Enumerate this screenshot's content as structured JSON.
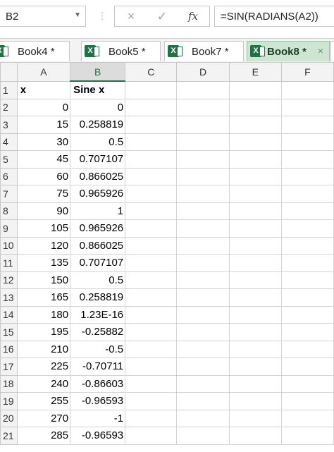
{
  "formula_bar": {
    "name_box": "B2",
    "formula": "=SIN(RADIANS(A2))",
    "cancel_icon": "×",
    "enter_icon": "✓",
    "fx_icon": "fx"
  },
  "tabs": [
    {
      "label": "Book4 *",
      "active": false
    },
    {
      "label": "Book5 *",
      "active": false
    },
    {
      "label": "Book7 *",
      "active": false
    },
    {
      "label": "Book8 *",
      "active": true,
      "close": "×"
    }
  ],
  "columns": [
    "A",
    "B",
    "C",
    "D",
    "E",
    "F"
  ],
  "selected_column": "B",
  "rows": [
    {
      "n": "1",
      "a": "x",
      "b": "Sine x"
    },
    {
      "n": "2",
      "a": "0",
      "b": "0"
    },
    {
      "n": "3",
      "a": "15",
      "b": "0.258819"
    },
    {
      "n": "4",
      "a": "30",
      "b": "0.5"
    },
    {
      "n": "5",
      "a": "45",
      "b": "0.707107"
    },
    {
      "n": "6",
      "a": "60",
      "b": "0.866025"
    },
    {
      "n": "7",
      "a": "75",
      "b": "0.965926"
    },
    {
      "n": "8",
      "a": "90",
      "b": "1"
    },
    {
      "n": "9",
      "a": "105",
      "b": "0.965926"
    },
    {
      "n": "10",
      "a": "120",
      "b": "0.866025"
    },
    {
      "n": "11",
      "a": "135",
      "b": "0.707107"
    },
    {
      "n": "12",
      "a": "150",
      "b": "0.5"
    },
    {
      "n": "13",
      "a": "165",
      "b": "0.258819"
    },
    {
      "n": "14",
      "a": "180",
      "b": "1.23E-16"
    },
    {
      "n": "15",
      "a": "195",
      "b": "-0.25882"
    },
    {
      "n": "16",
      "a": "210",
      "b": "-0.5"
    },
    {
      "n": "17",
      "a": "225",
      "b": "-0.70711"
    },
    {
      "n": "18",
      "a": "240",
      "b": "-0.86603"
    },
    {
      "n": "19",
      "a": "255",
      "b": "-0.96593"
    },
    {
      "n": "20",
      "a": "270",
      "b": "-1"
    },
    {
      "n": "21",
      "a": "285",
      "b": "-0.96593"
    }
  ],
  "colors": {
    "accent": "#217346",
    "active_tab": "#cfe5d4"
  }
}
